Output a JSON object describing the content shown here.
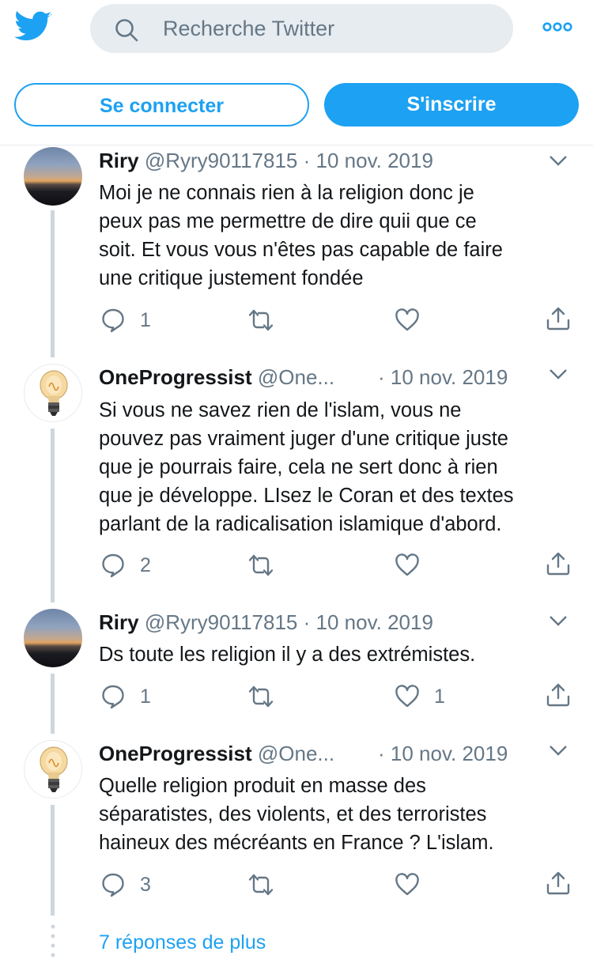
{
  "header": {
    "search_placeholder": "Recherche Twitter",
    "login_label": "Se connecter",
    "signup_label": "S'inscrire",
    "logo_icon": "twitter-bird-icon",
    "more_icon": "more-dots-icon"
  },
  "colors": {
    "accent": "#1da1f2",
    "muted": "#657786",
    "text": "#14171a",
    "thread_line": "#ccd6dd"
  },
  "tweets": [
    {
      "name": "Riry",
      "handle": "@Ryry90117815",
      "date": "· 10 nov. 2019",
      "text": "Moi je ne connais rien à la  religion donc je\npeux pas me permettre de dire quii que ce\nsoit. Et vous vous n'êtes pas capable de faire\nune critique justement fondée",
      "replies": "1",
      "retweets": "",
      "likes": ""
    },
    {
      "name": "OneProgressist",
      "handle": "@One...",
      "date": "· 10 nov. 2019",
      "text": "Si vous ne savez rien de l'islam, vous ne\npouvez pas vraiment juger d'une critique juste\nque je pourrais faire, cela ne sert donc à rien\nque je développe. LIsez le Coran et des textes\nparlant de la radicalisation islamique d'abord.",
      "replies": "2",
      "retweets": "",
      "likes": ""
    },
    {
      "name": "Riry",
      "handle": "@Ryry90117815",
      "date": "· 10 nov. 2019",
      "text": "Ds toute les religion il y a des extrémistes.",
      "replies": "1",
      "retweets": "",
      "likes": "1"
    },
    {
      "name": "OneProgressist",
      "handle": "@One...",
      "date": "· 10 nov. 2019",
      "text": "Quelle religion produit en masse des\nséparatistes, des violents, et des terroristes\nhaineux des mécréants en France ? L'islam.",
      "replies": "3",
      "retweets": "",
      "likes": ""
    }
  ],
  "more_replies_label": "7 réponses de plus"
}
